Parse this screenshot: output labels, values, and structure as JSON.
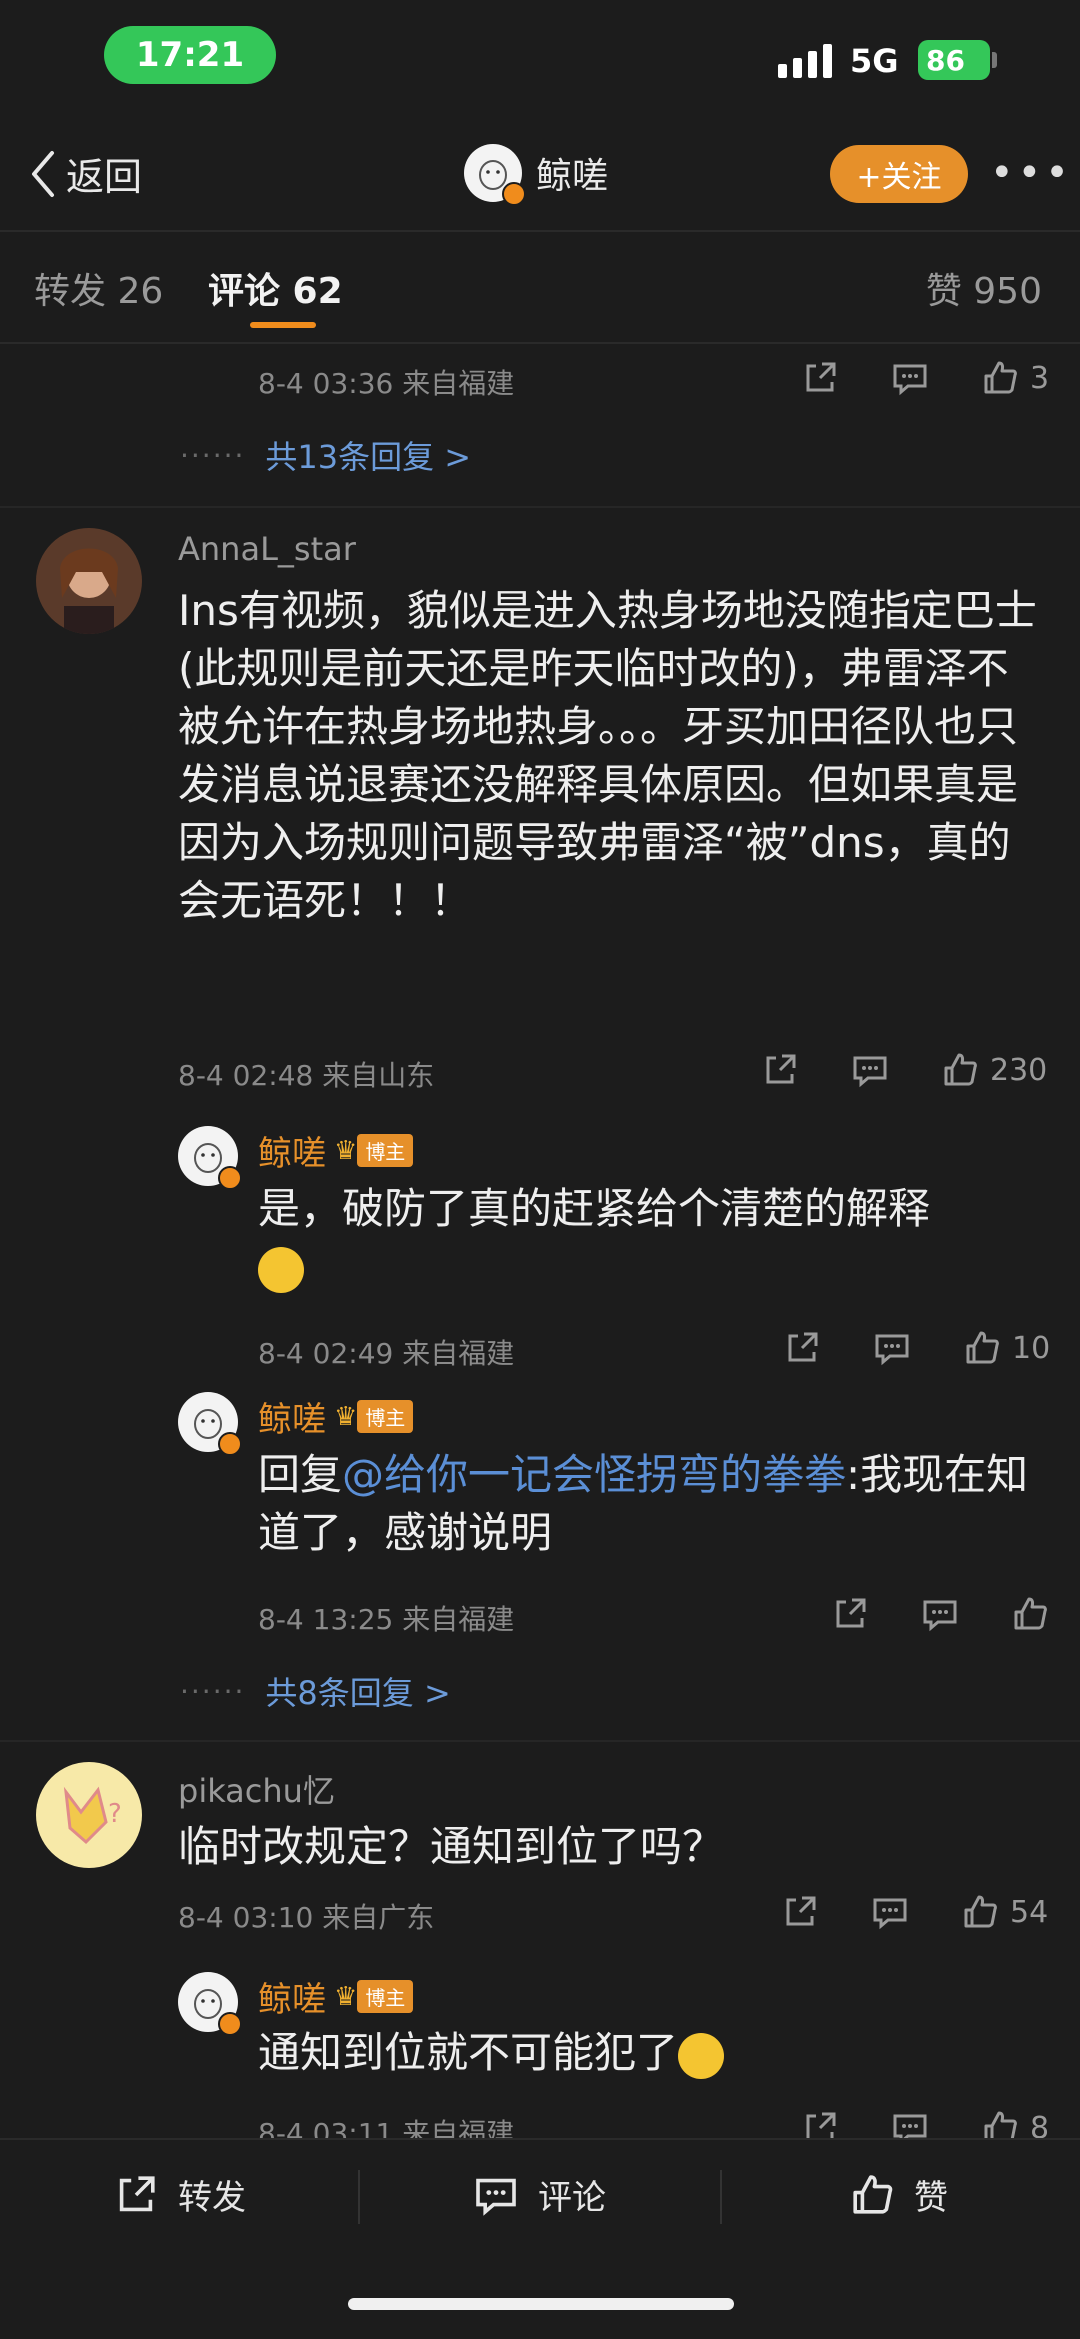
{
  "status_bar": {
    "time": "17:21",
    "network": "5G",
    "battery": "86"
  },
  "nav": {
    "back_label": "返回",
    "title": "鲸嗟",
    "follow_label": "+关注",
    "more_label": "•••"
  },
  "tabs": {
    "repost": "转发 26",
    "comment": "评论 62",
    "like": "赞 950"
  },
  "colors": {
    "accent": "#f08c1c",
    "link": "#5b8fd6",
    "background": "#1c1c1c"
  },
  "thread0": {
    "meta": "8-4 03:36 来自福建",
    "likes": "3",
    "more_replies": "共13条回复 >",
    "dots": "······"
  },
  "comments": [
    {
      "user": "AnnaL_star",
      "text": "Ins有视频，貌似是进入热身场地没随指定巴士 (此规则是前天还是昨天临时改的)，弗雷泽不被允许在热身场地热身。。。牙买加田径队也只发消息说退赛还没解释具体原因。但如果真是因为入场规则问题导致弗雷泽“被”dns，真的会无语死！！！",
      "meta": "8-4 02:48 来自山东",
      "likes": "230",
      "replies": [
        {
          "user": "鲸嗟",
          "badge": "博主",
          "text": "是，破防了真的赶紧给个清楚的解释",
          "meta": "8-4 02:49 来自福建",
          "likes": "10"
        },
        {
          "user": "鲸嗟",
          "badge": "博主",
          "prefix": "回复",
          "mention": "@给你一记会怪拐弯的拳拳",
          "text": ":我现在知道了，感谢说明",
          "meta": "8-4 13:25 来自福建",
          "likes": ""
        }
      ],
      "more_replies": "共8条回复 >"
    },
    {
      "user": "pikachu忆",
      "text": "临时改规定？通知到位了吗？",
      "meta": "8-4 03:10 来自广东",
      "likes": "54",
      "replies": [
        {
          "user": "鲸嗟",
          "badge": "博主",
          "text": "通知到位就不可能犯了",
          "meta": "8-4 03:11 来自福建",
          "likes": "8"
        }
      ]
    }
  ],
  "bottom_bar": {
    "repost": "转发",
    "comment": "评论",
    "like": "赞"
  },
  "icons": [
    "back-chevron-icon",
    "share-icon",
    "comment-icon",
    "thumb-up-icon",
    "crown-icon",
    "more-dots-icon"
  ]
}
